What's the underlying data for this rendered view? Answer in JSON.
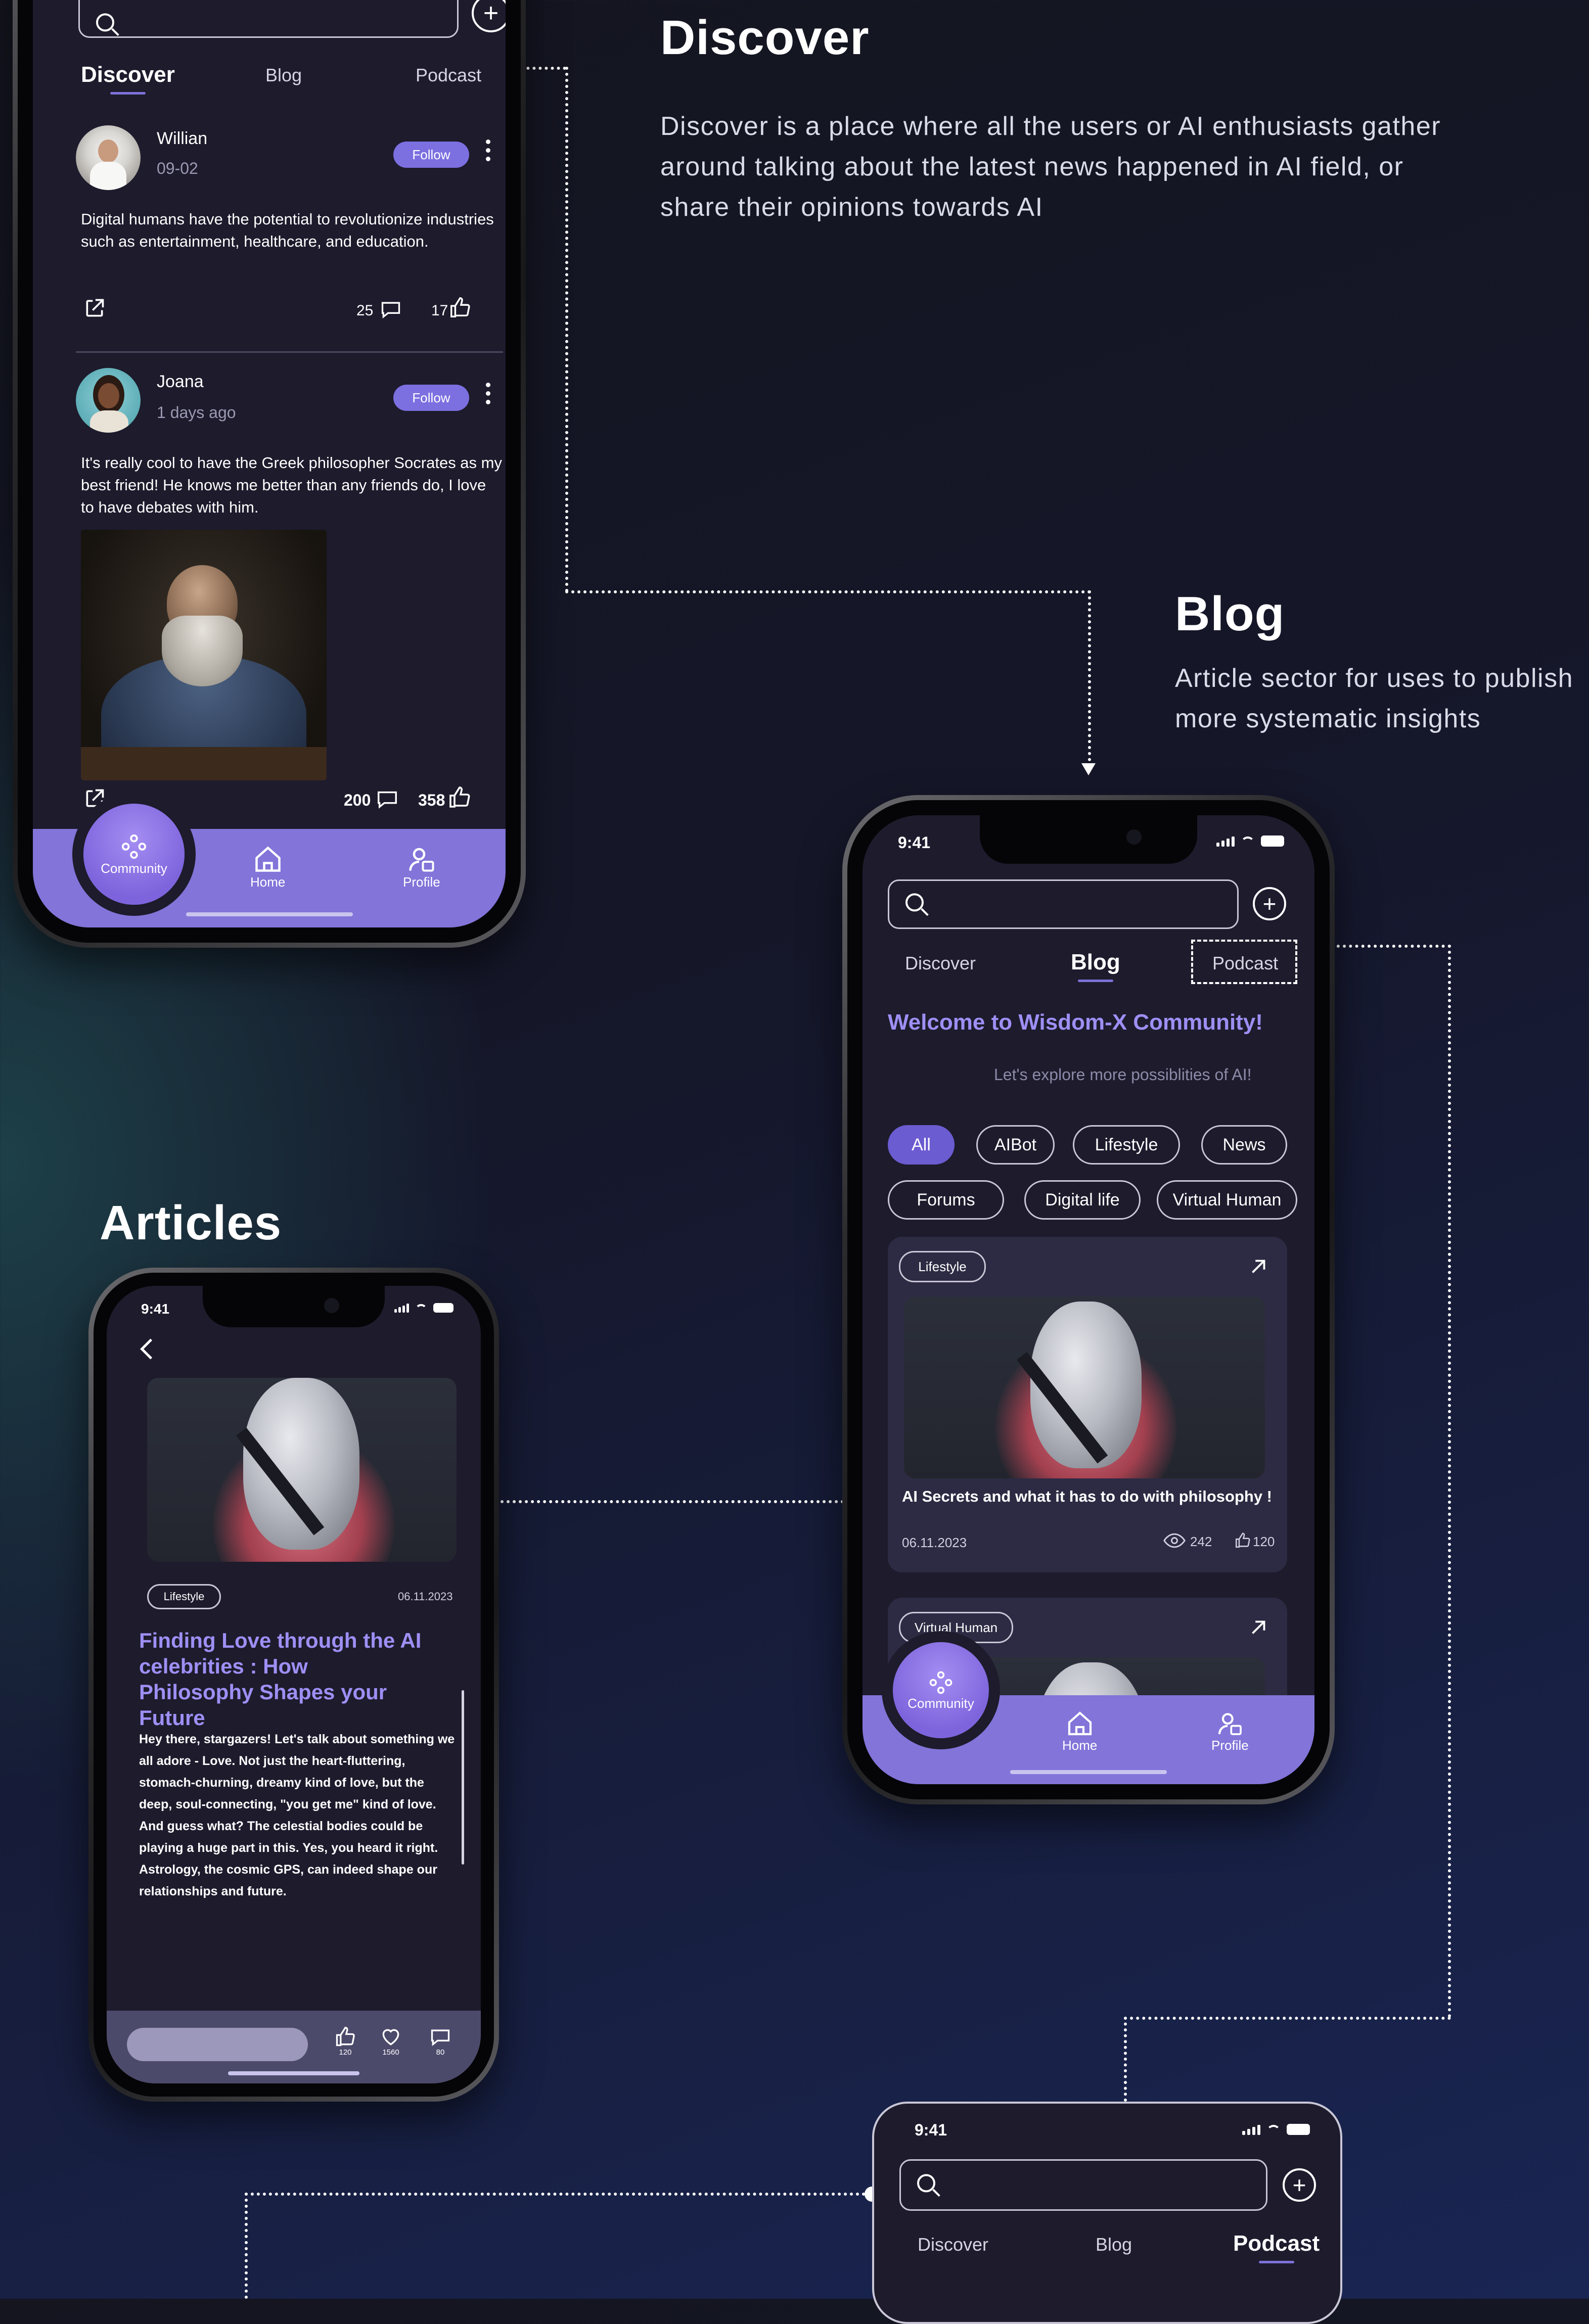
{
  "sections": {
    "discover": {
      "title": "Discover",
      "description": "Discover is a place where all the users or AI enthusiasts gather around talking about the latest news happened in AI field, or share their opinions towards  AI"
    },
    "blog": {
      "title": "Blog",
      "description": "Article sector for uses to publish more systematic insights"
    },
    "articles": {
      "title": "Articles"
    }
  },
  "status_bar": {
    "time": "9:41"
  },
  "tabs": {
    "discover": "Discover",
    "blog": "Blog",
    "podcast": "Podcast"
  },
  "discover_phone": {
    "posts": [
      {
        "author": "Willian",
        "date": "09-02",
        "follow_label": "Follow",
        "text": "Digital humans have the potential to revolutionize industries such as entertainment, healthcare, and education.",
        "comments": "25",
        "likes": "17"
      },
      {
        "author": "Joana",
        "date": "1 days ago",
        "follow_label": "Follow",
        "text": "It's really cool to have the Greek philosopher Socrates as my best friend! He knows me better than any friends do, I love to have debates with him.",
        "comments": "200",
        "likes": "358"
      }
    ]
  },
  "bottom_nav": {
    "community": "Community",
    "home": "Home",
    "profile": "Profile"
  },
  "blog_phone": {
    "welcome_title": "Welcome to Wisdom-X Community!",
    "welcome_sub": "Let's explore more possiblities of AI!",
    "filters": [
      "All",
      "AIBot",
      "Lifestyle",
      "News",
      "Forums",
      "Digital life",
      "Virtual Human"
    ],
    "active_filter": "All",
    "cards": [
      {
        "tag": "Lifestyle",
        "title": "AI Secrets and what it has to do with philosophy !",
        "date": "06.11.2023",
        "views": "242",
        "likes": "120"
      },
      {
        "tag": "Virtual Human"
      }
    ]
  },
  "article_phone": {
    "tag": "Lifestyle",
    "date": "06.11.2023",
    "title": "Finding Love through the AI celebrities : How Philosophy Shapes your Future",
    "body": "Hey there, stargazers! Let's talk about something we all adore - Love. Not just the heart-fluttering, stomach-churning, dreamy kind of love, but the deep, soul-connecting, \"you get me\" kind of love. And guess what? The celestial bodies could be playing a huge part in this. Yes, you heard it right. Astrology, the cosmic GPS, can indeed shape our relationships and future.",
    "likes": "120",
    "favorites": "1560",
    "comments": "80"
  },
  "colors": {
    "accent": "#7c6fe0",
    "nav": "#8274d9",
    "screen": "#1d1b2c"
  }
}
